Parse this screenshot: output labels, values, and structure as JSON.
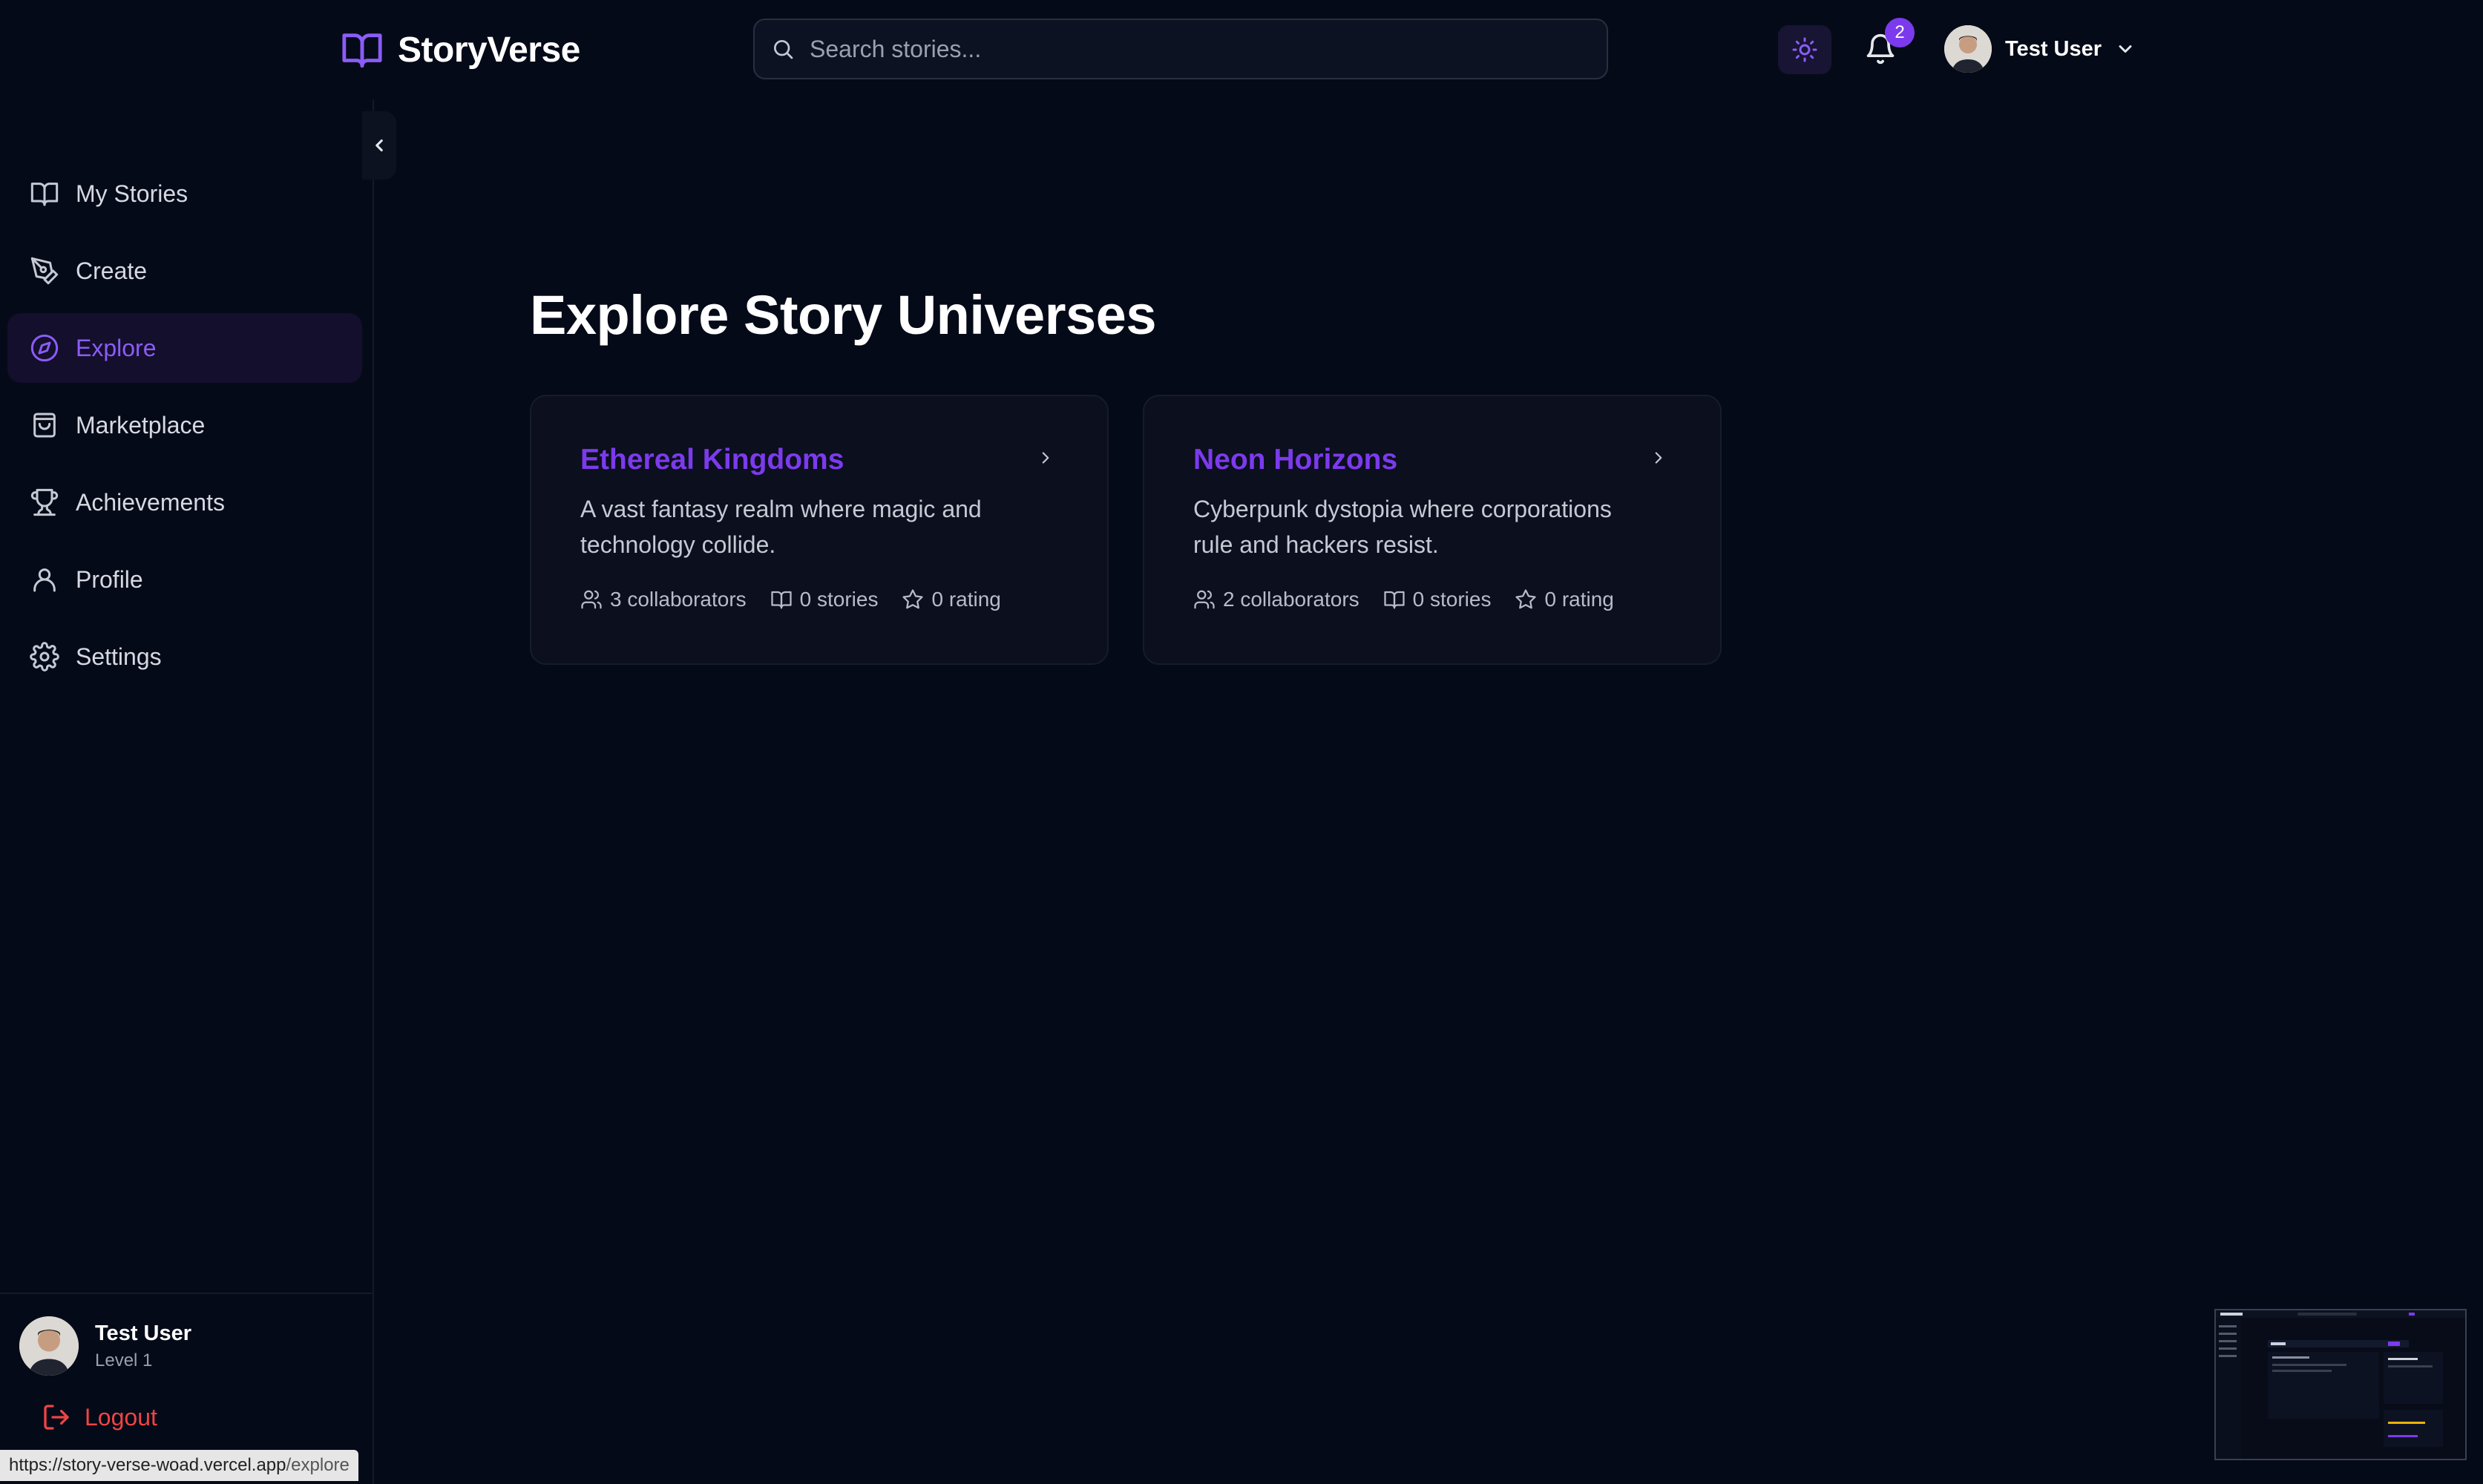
{
  "app": {
    "name": "StoryVerse"
  },
  "search": {
    "placeholder": "Search stories..."
  },
  "header": {
    "notification_count": "2",
    "user_name": "Test User"
  },
  "sidebar": {
    "items": [
      {
        "label": "My Stories",
        "icon": "book-open-icon",
        "active": false
      },
      {
        "label": "Create",
        "icon": "pen-tool-icon",
        "active": false
      },
      {
        "label": "Explore",
        "icon": "compass-icon",
        "active": true
      },
      {
        "label": "Marketplace",
        "icon": "shopping-bag-icon",
        "active": false
      },
      {
        "label": "Achievements",
        "icon": "trophy-icon",
        "active": false
      },
      {
        "label": "Profile",
        "icon": "user-icon",
        "active": false
      },
      {
        "label": "Settings",
        "icon": "gear-icon",
        "active": false
      }
    ],
    "user": {
      "name": "Test User",
      "level": "Level 1"
    },
    "logout_label": "Logout"
  },
  "main": {
    "title": "Explore Story Universes",
    "universes": [
      {
        "title": "Ethereal Kingdoms",
        "description": "A vast fantasy realm where magic and technology collide.",
        "collaborators": "3 collaborators",
        "stories": "0 stories",
        "rating": "0 rating"
      },
      {
        "title": "Neon Horizons",
        "description": "Cyberpunk dystopia where corporations rule and hackers resist.",
        "collaborators": "2 collaborators",
        "stories": "0 stories",
        "rating": "0 rating"
      }
    ]
  },
  "status_bar": {
    "url_host": "https://story-verse-woad.vercel.app",
    "url_path": "/explore"
  },
  "colors": {
    "accent": "#7c3aed",
    "background": "#050a18",
    "danger": "#ef4444"
  }
}
